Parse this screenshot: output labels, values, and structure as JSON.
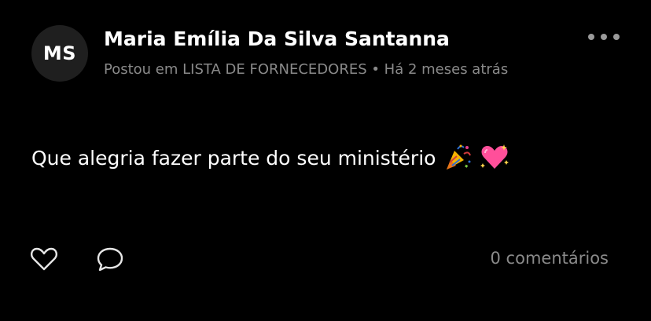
{
  "post": {
    "avatar_initials": "MS",
    "author_name": "Maria Emília Da Silva Santanna",
    "meta_text": "Postou em LISTA DE FORNECEDORES • Há 2 meses atrás",
    "message": "Que alegria fazer parte do seu ministério",
    "emojis": [
      "party-popper",
      "sparkling-heart"
    ],
    "comments_label": "0 comentários"
  },
  "icons": {
    "more": "more-horizontal-icon",
    "like": "heart-outline-icon",
    "comment": "speech-bubble-icon"
  },
  "colors": {
    "background": "#000000",
    "text_primary": "#ffffff",
    "text_secondary": "#8a8a8a",
    "avatar_bg": "#1f1f1f"
  }
}
